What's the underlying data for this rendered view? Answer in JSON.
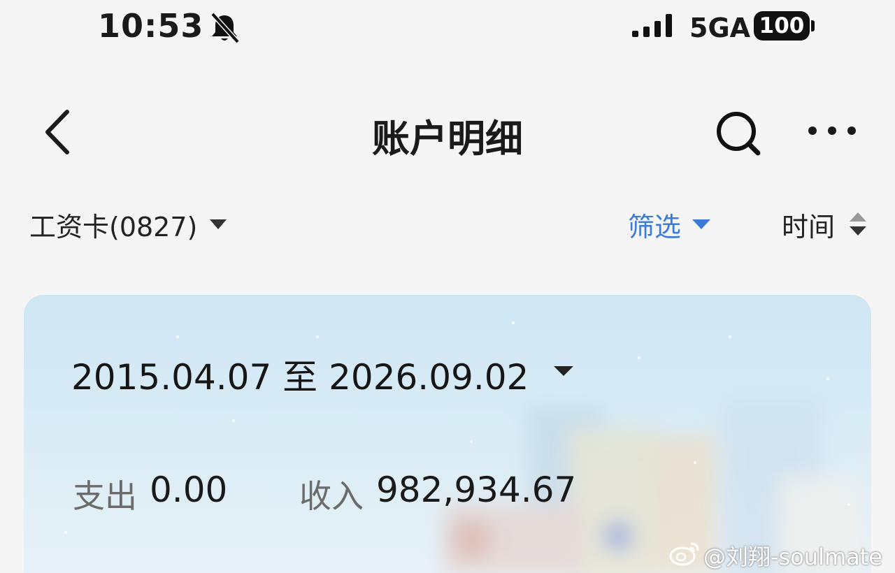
{
  "status_bar": {
    "time": "10:53",
    "network": "5GA",
    "battery": "100",
    "icons": [
      "bell-muted-icon",
      "signal-icon",
      "battery-icon"
    ]
  },
  "nav": {
    "title": "账户明细",
    "icons": [
      "back-arrow-icon",
      "search-icon",
      "more-icon"
    ]
  },
  "filters": {
    "account": "工资卡(0827)",
    "filter_label": "筛选",
    "sort_label": "时间",
    "accent_color": "#3c7bd8"
  },
  "summary": {
    "date_range": "2015.04.07 至 2026.09.02",
    "expense_label": "支出",
    "expense_value": "0.00",
    "income_label": "收入",
    "income_value": "982,934.67"
  },
  "watermark": {
    "text": "@刘翔-soulmate"
  }
}
